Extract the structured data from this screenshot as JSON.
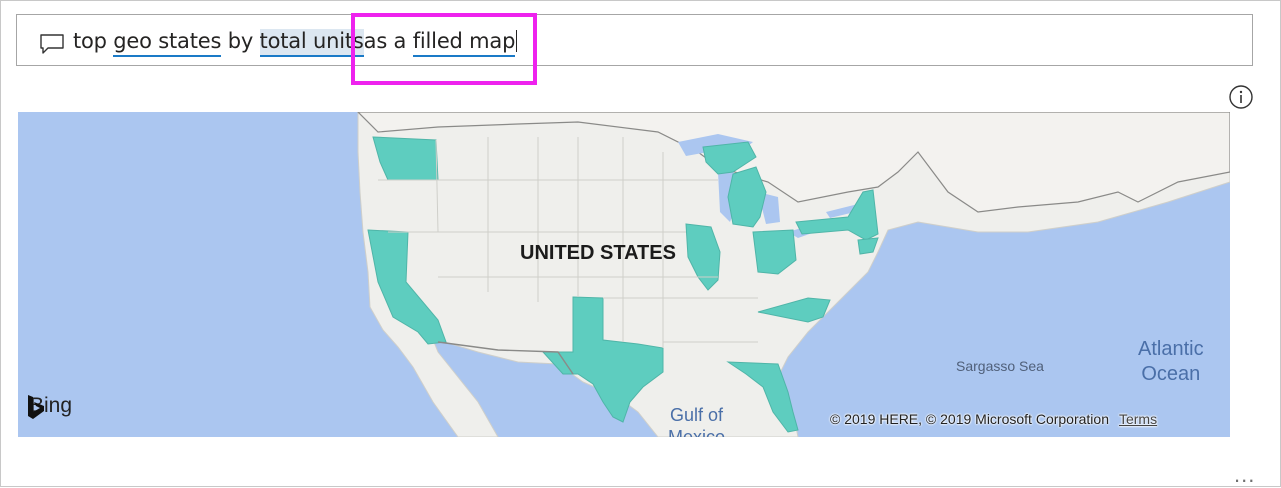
{
  "qna": {
    "query_tokens": [
      {
        "text": "top",
        "style": "plain"
      },
      {
        "text": "geo states",
        "style": "term"
      },
      {
        "text": "by",
        "style": "plain"
      },
      {
        "text": "total units",
        "style": "term-highlight"
      },
      {
        "text": "as a",
        "style": "plain"
      },
      {
        "text": "filled map",
        "style": "term"
      }
    ]
  },
  "map": {
    "country_label": "UNITED STATES",
    "sea_label": "Sargasso Sea",
    "ocean_label": [
      "Atlantic",
      "Ocean"
    ],
    "gulf_label": [
      "Gulf of",
      "Mexico"
    ],
    "bing_label": "Bing",
    "copyright": "© 2019 HERE, © 2019 Microsoft Corporation",
    "terms": "Terms",
    "fill_color": "#5ecdbf",
    "land_color": "#efefec",
    "water_color": "#abc6f0",
    "filled_states": [
      "Washington",
      "California",
      "Texas",
      "Illinois",
      "Michigan",
      "Ohio",
      "New York",
      "North Carolina",
      "Florida",
      "New Jersey"
    ]
  },
  "icons": {
    "chat": "chat-bubble-icon",
    "info": "info-icon",
    "more": "more-options-icon"
  },
  "more_label": "..."
}
